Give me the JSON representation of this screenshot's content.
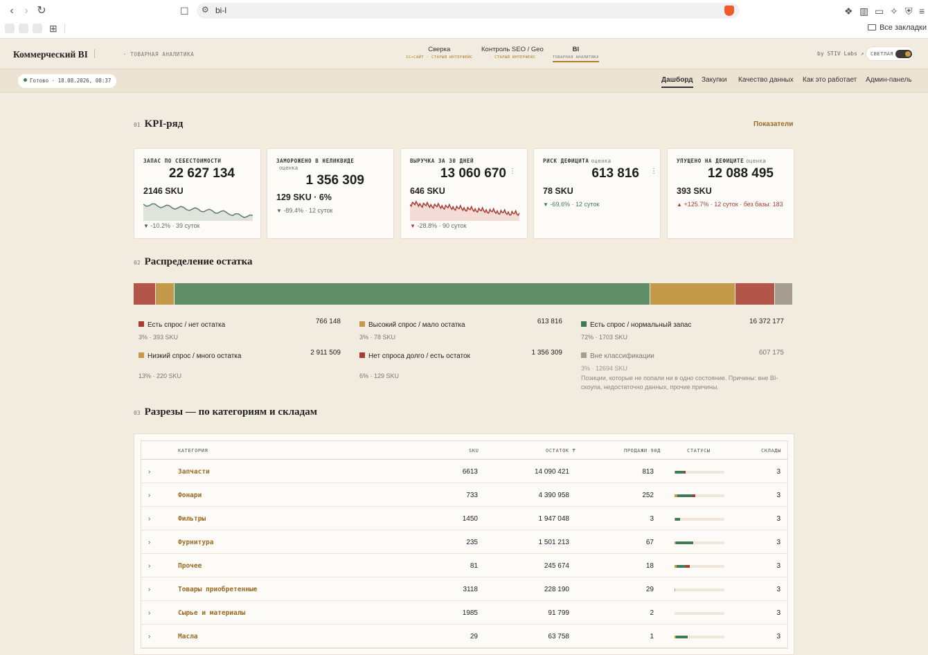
{
  "browser": {
    "url": "bi-l",
    "all_bookmarks": "Все закладки"
  },
  "app": {
    "brand": "Коммерческий BI",
    "subtitle": "· ТОВАРНАЯ АНАЛИТИКА",
    "tabs": [
      {
        "label": "Сверка",
        "sub": "1С+САЙТ · СТАРЫЙ ИНТЕРФЕЙС"
      },
      {
        "label": "Контроль SEO / Geo",
        "sub": "· СТАРЫЙ ИНТЕРФЕЙС"
      },
      {
        "label": "BI",
        "sub": "ТОВАРНАЯ АНАЛИТИКА"
      }
    ],
    "byline": "by STIV Labs ↗",
    "theme_label": "СВЕТЛАЯ"
  },
  "subnav": {
    "status": "Готово · 18.08.2026, 08:37",
    "links": [
      "Дашборд",
      "Закупки",
      "Качество данных",
      "Как это работает",
      "Админ-панель"
    ]
  },
  "kpi": {
    "num": "01",
    "title": "KPI-ряд",
    "link": "Показатели",
    "cards": [
      {
        "label": "ЗАПАС ПО СЕБЕСТОИМОСТИ",
        "est": "",
        "value": "22 627 134",
        "sku": "2146 SKU",
        "arrow": "▼",
        "delta": "-10.2% · 39 суток"
      },
      {
        "label": "ЗАМОРОЖЕНО В НЕЛИКВИДЕ",
        "est": "оценка",
        "value": "1 356 309",
        "sku": "129 SKU · 6%",
        "arrow": "▼",
        "delta": "-89.4% · 12 суток"
      },
      {
        "label": "ВЫРУЧКА ЗА 30 ДНЕЙ",
        "est": "",
        "value": "13 060 670",
        "sku": "646 SKU",
        "arrow": "▼",
        "delta": "-28.8% · 90 суток"
      },
      {
        "label": "РИСК ДЕФИЦИТА",
        "est": "оценка",
        "value": "613 816",
        "sku": "78 SKU",
        "arrow": "▼",
        "delta": "-69.6% · 12 суток"
      },
      {
        "label": "УПУЩЕНО НА ДЕФИЦИТЕ",
        "est": "оценка",
        "value": "12 088 495",
        "sku": "393 SKU",
        "arrow": "▲",
        "delta": "+125.7% · 12 суток · без базы: 183"
      }
    ],
    "colors": {
      "down": "#3e7a55",
      "up": "#b04a3a",
      "neutral": "#555"
    }
  },
  "distribution": {
    "num": "02",
    "title": "Распределение остатка",
    "segments": [
      {
        "share": 3.4,
        "color": "#b4554a"
      },
      {
        "share": 2.8,
        "color": "#c4994a"
      },
      {
        "share": 72.0,
        "color": "#5f8e68"
      },
      {
        "share": 12.9,
        "color": "#c4994a"
      },
      {
        "share": 6.0,
        "color": "#b4554a"
      },
      {
        "share": 2.7,
        "color": "#a59d92"
      }
    ],
    "legend": [
      {
        "name": "Есть спрос / нет остатка",
        "amount": "766 148",
        "sub": "3% · 393 SKU",
        "color": "#a83c33"
      },
      {
        "name": "Высокий спрос / мало остатка",
        "amount": "613 816",
        "sub": "3% · 78 SKU",
        "color": "#c4994a"
      },
      {
        "name": "Есть спрос / нормальный запас",
        "amount": "16 372 177",
        "sub": "72% · 1703 SKU",
        "color": "#3e7a55"
      },
      {
        "name": "Низкий спрос / много остатка",
        "amount": "2 911 509",
        "sub": "13% · 220 SKU",
        "color": "#c4994a"
      },
      {
        "name": "Нет спроса долго / есть остаток",
        "amount": "1 356 309",
        "sub": "6% · 129 SKU",
        "color": "#a83c33"
      },
      {
        "name": "Вне классификации",
        "amount": "607 175",
        "sub": "3% · 12694 SKU",
        "color": "#a59d92",
        "note": "Позиции, которые не попали ни в одно состояние. Причины: вне BI-скоупа, недостаточно данных, прочие причины."
      }
    ]
  },
  "cuts": {
    "num": "03",
    "title": "Разрезы — по категориям и складам",
    "headers": [
      "КАТЕГОРИЯ",
      "SKU",
      "ОСТАТОК ₸",
      "ПРОДАЖИ 90Д",
      "СТАТУСЫ",
      "СКЛАДЫ"
    ],
    "rows": [
      {
        "cat": "Запчасти",
        "sku": "6613",
        "stock": "14 090 421",
        "sales": "813",
        "wh": "3",
        "st": [
          0.02,
          0.18,
          0.02
        ]
      },
      {
        "cat": "Фонари",
        "sku": "733",
        "stock": "4 390 958",
        "sales": "252",
        "wh": "3",
        "st": [
          0.06,
          0.3,
          0.06
        ]
      },
      {
        "cat": "Фильтры",
        "sku": "1450",
        "stock": "1 947 048",
        "sales": "3",
        "wh": "3",
        "st": [
          0.02,
          0.09,
          0.0
        ]
      },
      {
        "cat": "Фурнитура",
        "sku": "235",
        "stock": "1 501 213",
        "sales": "67",
        "wh": "3",
        "st": [
          0.03,
          0.34,
          0.0
        ]
      },
      {
        "cat": "Прочее",
        "sku": "81",
        "stock": "245 674",
        "sales": "18",
        "wh": "3",
        "st": [
          0.04,
          0.18,
          0.08
        ]
      },
      {
        "cat": "Товары приобретенные",
        "sku": "3118",
        "stock": "228 190",
        "sales": "29",
        "wh": "3",
        "st": [
          0.02,
          0.0,
          0.0
        ]
      },
      {
        "cat": "Сырье и материалы",
        "sku": "1985",
        "stock": "91 799",
        "sales": "2",
        "wh": "3",
        "st": [
          0.0,
          0.0,
          0.0
        ]
      },
      {
        "cat": "Масла",
        "sku": "29",
        "stock": "63 758",
        "sales": "1",
        "wh": "3",
        "st": [
          0.03,
          0.24,
          0.0
        ]
      }
    ]
  }
}
